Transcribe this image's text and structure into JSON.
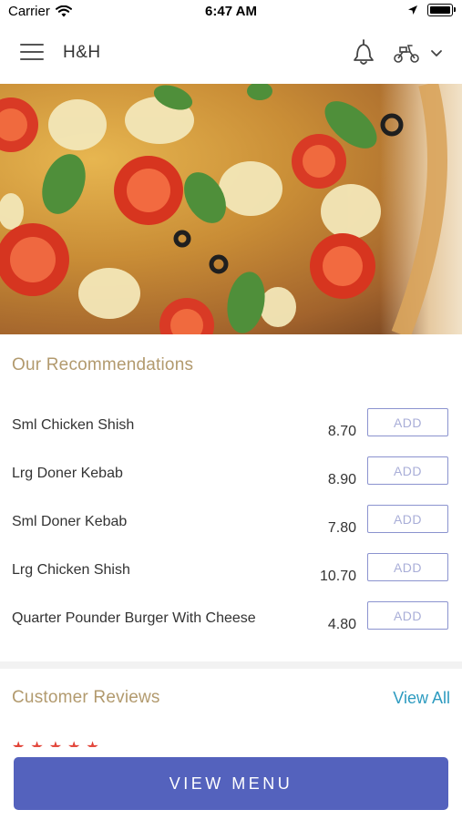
{
  "status_bar": {
    "carrier": "Carrier",
    "time": "6:47 AM"
  },
  "header": {
    "title": "H&H",
    "icons": [
      "menu-icon",
      "bell-icon",
      "scooter-icon",
      "chevron-down-icon"
    ]
  },
  "hero": {
    "image": "pizza-photo"
  },
  "recommendations": {
    "title": "Our Recommendations",
    "add_label": "ADD",
    "items": [
      {
        "name": "Sml Chicken Shish",
        "price": "8.70"
      },
      {
        "name": "Lrg Doner Kebab",
        "price": "8.90"
      },
      {
        "name": "Sml Doner Kebab",
        "price": "7.80"
      },
      {
        "name": "Lrg Chicken Shish",
        "price": "10.70"
      },
      {
        "name": "Quarter Pounder Burger With Cheese",
        "price": "4.80"
      }
    ]
  },
  "reviews": {
    "title": "Customer Reviews",
    "view_all": "View All",
    "first_review": {
      "stars": "★★★★★",
      "rating": 5
    }
  },
  "footer": {
    "view_menu_label": "VIEW MENU"
  },
  "colors": {
    "accent": "#5462bd",
    "section_title": "#b29a6e",
    "link": "#2d9bc0",
    "star": "#e0382c"
  }
}
